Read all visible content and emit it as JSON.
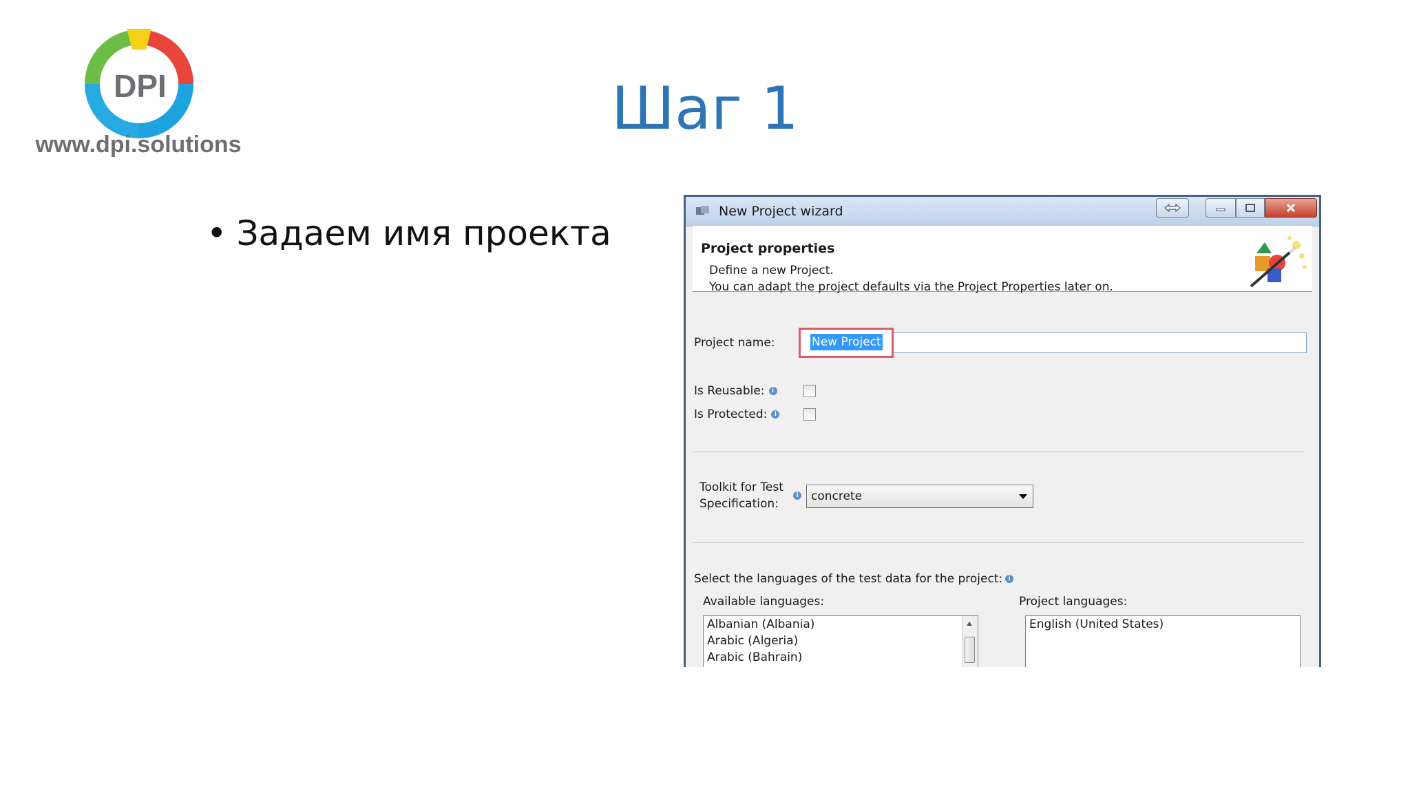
{
  "logo": {
    "text": "DPI",
    "url": "www.dpi.solutions"
  },
  "slide": {
    "title": "Шаг 1",
    "bullet": "Задаем имя проекта"
  },
  "dialog": {
    "title": "New Project wizard",
    "header": {
      "title": "Project properties",
      "desc_line1": "Define a new Project.",
      "desc_line2": "You can adapt the project defaults via the Project Properties later on."
    },
    "project_name": {
      "label": "Project name:",
      "value": "New Project"
    },
    "is_reusable": {
      "label": "Is Reusable:",
      "checked": false
    },
    "is_protected": {
      "label": "Is Protected:",
      "checked": false
    },
    "toolkit": {
      "label_line1": "Toolkit for Test",
      "label_line2": "Specification:",
      "value": "concrete"
    },
    "languages": {
      "prompt": "Select the languages of the test data for the project:",
      "available_label": "Available languages:",
      "available": [
        "Albanian (Albania)",
        "Arabic (Algeria)",
        "Arabic (Bahrain)"
      ],
      "project_label": "Project languages:",
      "project": [
        "English (United States)"
      ]
    },
    "icons": {
      "app": "wizard-app-icon",
      "swap": "swap-arrows-icon",
      "minimize": "minimize-icon",
      "maximize": "maximize-icon",
      "close": "close-icon",
      "wizard": "magic-wand-shapes-icon",
      "info": "info-icon"
    }
  },
  "colors": {
    "title_blue": "#2e75b6",
    "highlight_red": "#e05a6a",
    "selection_blue": "#3399ff"
  }
}
